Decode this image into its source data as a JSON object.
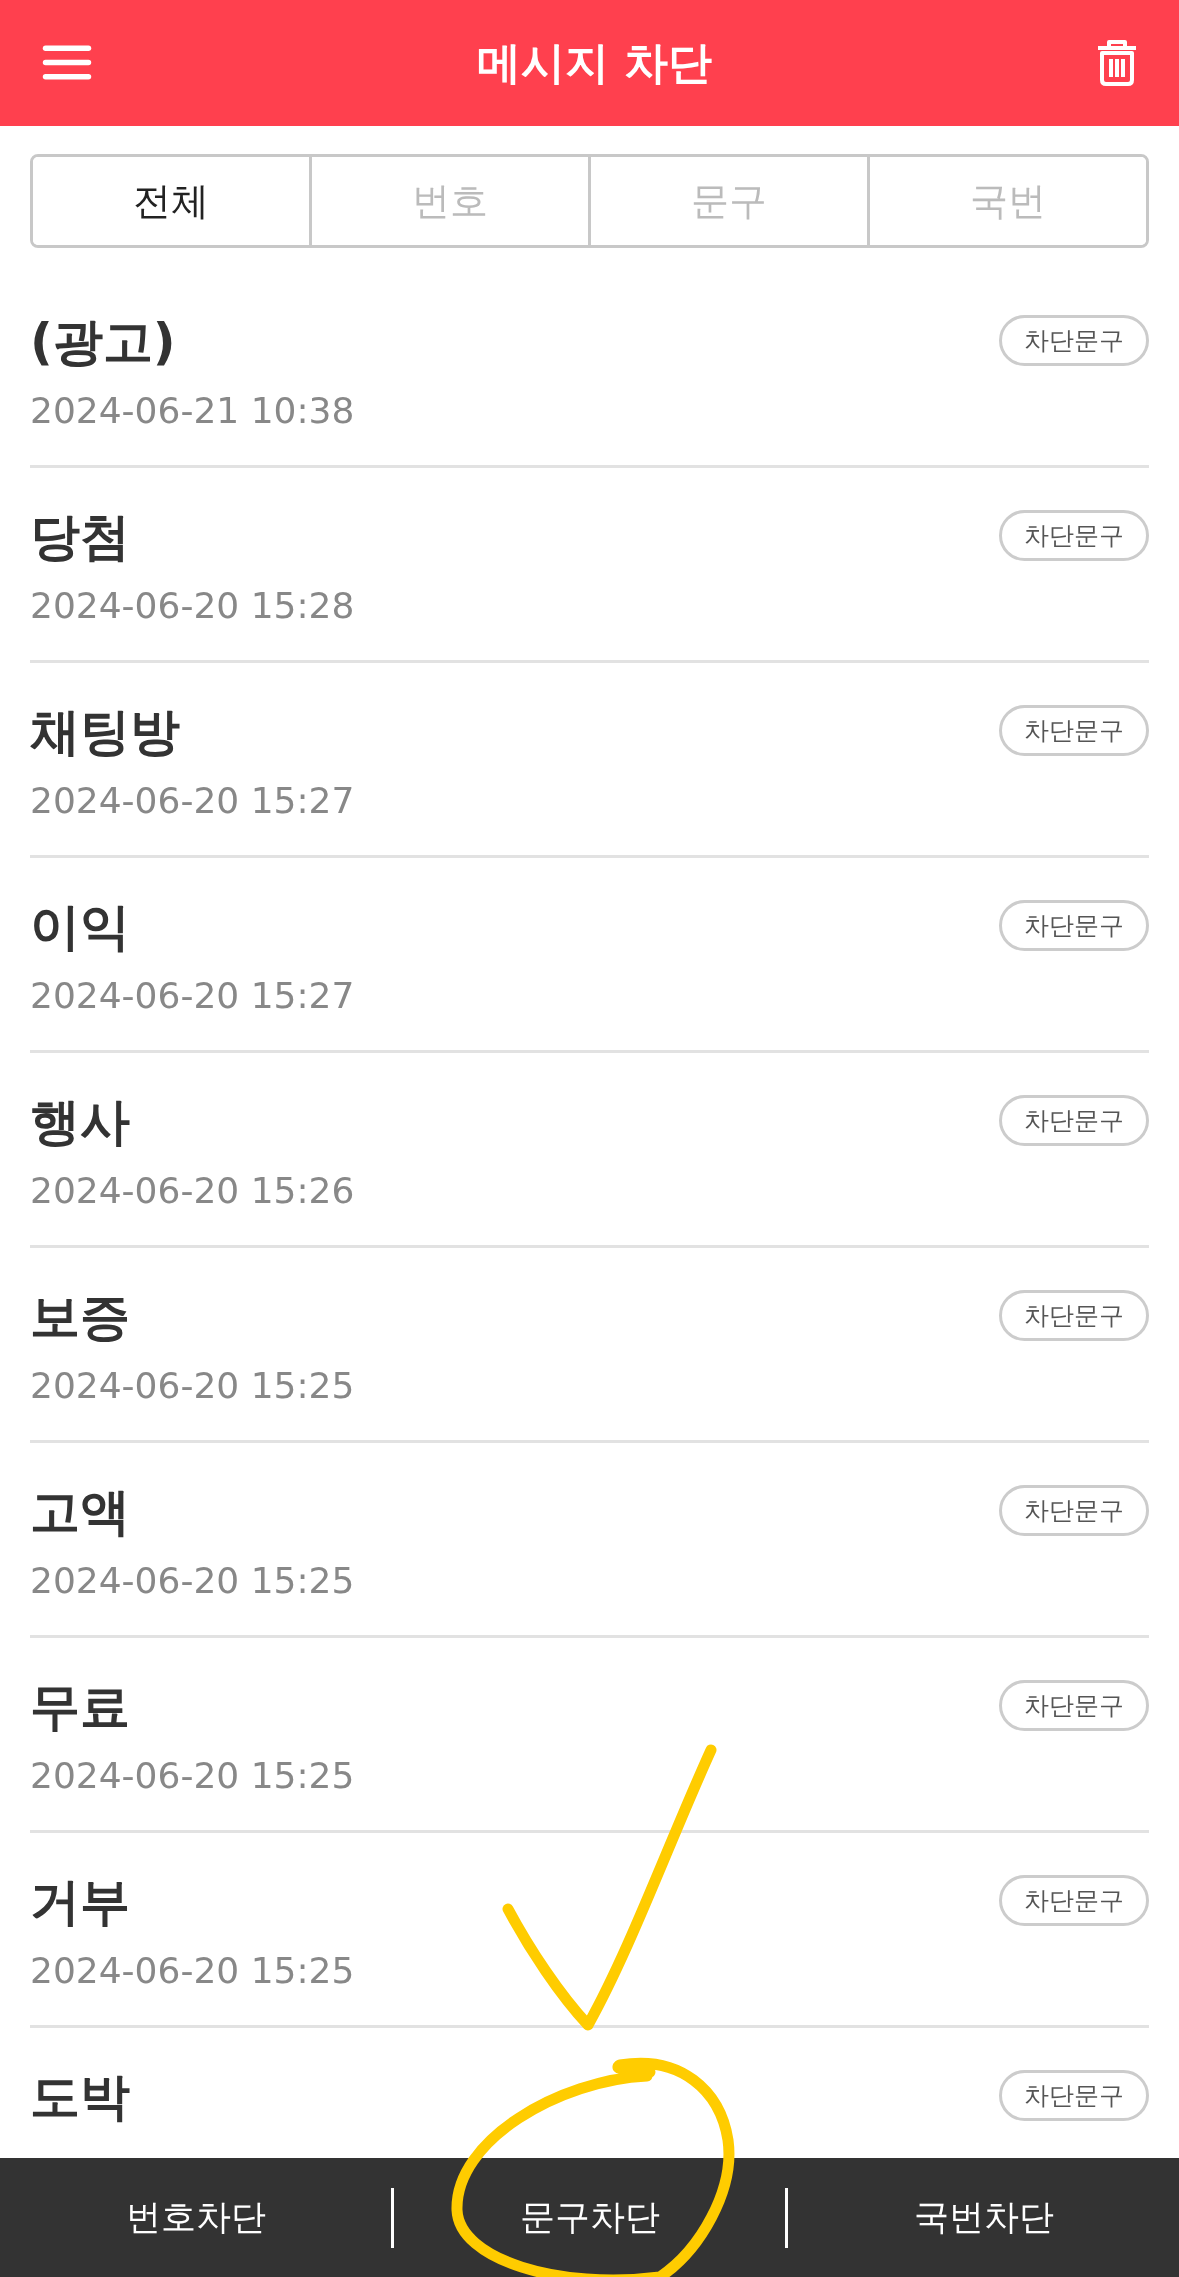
{
  "header": {
    "title": "메시지 차단"
  },
  "tabs": [
    {
      "label": "전체",
      "selected": true
    },
    {
      "label": "번호",
      "selected": false
    },
    {
      "label": "문구",
      "selected": false
    },
    {
      "label": "국번",
      "selected": false
    }
  ],
  "items": [
    {
      "title": "(광고)",
      "date": "2024-06-21 10:38",
      "badge": "차단문구"
    },
    {
      "title": "당첨",
      "date": "2024-06-20 15:28",
      "badge": "차단문구"
    },
    {
      "title": "채팅방",
      "date": "2024-06-20 15:27",
      "badge": "차단문구"
    },
    {
      "title": "이익",
      "date": "2024-06-20 15:27",
      "badge": "차단문구"
    },
    {
      "title": "행사",
      "date": "2024-06-20 15:26",
      "badge": "차단문구"
    },
    {
      "title": "보증",
      "date": "2024-06-20 15:25",
      "badge": "차단문구"
    },
    {
      "title": "고액",
      "date": "2024-06-20 15:25",
      "badge": "차단문구"
    },
    {
      "title": "무료",
      "date": "2024-06-20 15:25",
      "badge": "차단문구"
    },
    {
      "title": "거부",
      "date": "2024-06-20 15:25",
      "badge": "차단문구"
    },
    {
      "title": "도박",
      "badge": "차단문구"
    }
  ],
  "bottom_bar": [
    "번호차단",
    "문구차단",
    "국번차단"
  ]
}
